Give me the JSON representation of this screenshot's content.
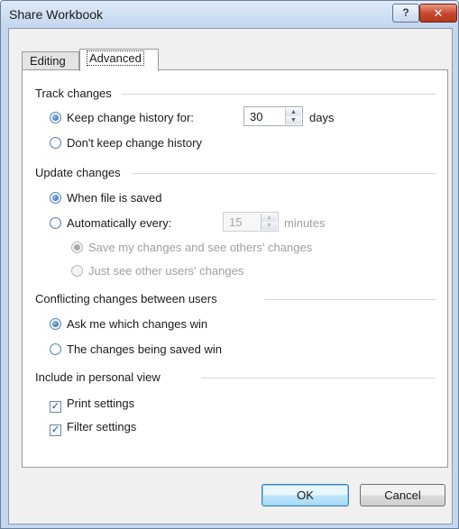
{
  "window": {
    "title": "Share Workbook",
    "help_label": "?",
    "close_label": "✕"
  },
  "tabs": [
    {
      "label": "Editing",
      "selected": false
    },
    {
      "label": "Advanced",
      "selected": true
    }
  ],
  "track_changes": {
    "title": "Track changes",
    "keep_history_label": "Keep change history for:",
    "keep_history_selected": true,
    "days_value": "30",
    "days_unit": "days",
    "dont_keep_label": "Don't keep change history",
    "dont_keep_selected": false
  },
  "update_changes": {
    "title": "Update changes",
    "when_saved_label": "When file is saved",
    "when_saved_selected": true,
    "auto_label": "Automatically every:",
    "auto_selected": false,
    "minutes_value": "15",
    "minutes_unit": "minutes",
    "save_mine_label": "Save my changes and see others' changes",
    "save_mine_selected": true,
    "just_see_label": "Just see other users' changes",
    "just_see_selected": false
  },
  "conflicting": {
    "title": "Conflicting changes between users",
    "ask_label": "Ask me which changes win",
    "ask_selected": true,
    "saved_win_label": "The changes being saved win",
    "saved_win_selected": false
  },
  "personal_view": {
    "title": "Include in personal view",
    "print_label": "Print settings",
    "print_checked": true,
    "filter_label": "Filter settings",
    "filter_checked": true
  },
  "buttons": {
    "ok_label": "OK",
    "cancel_label": "Cancel"
  },
  "colors": {
    "frame": "#c4d7ee",
    "close_button": "#c4452c",
    "radio_selected": "#1e5ea8"
  }
}
